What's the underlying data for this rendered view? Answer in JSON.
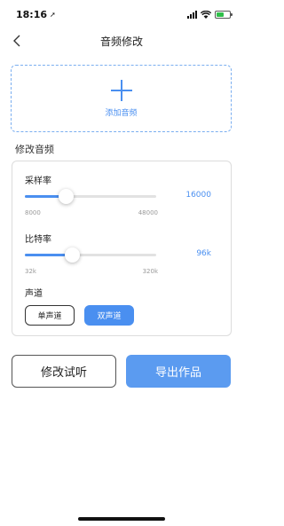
{
  "status_bar": {
    "time": "18:16",
    "location_glyph": "➚"
  },
  "nav": {
    "title": "音频修改",
    "back_icon": "chevron-left-icon"
  },
  "upload": {
    "label": "添加音频",
    "icon": "plus-icon"
  },
  "section": {
    "title": "修改音频"
  },
  "sample_rate": {
    "label": "采样率",
    "value": "16000",
    "min_label": "8000",
    "max_label": "48000",
    "fraction": 0.31
  },
  "bit_rate": {
    "label": "比特率",
    "value": "96k",
    "min_label": "32k",
    "max_label": "320k",
    "fraction": 0.36
  },
  "channel": {
    "label": "声道",
    "options": [
      "单声道",
      "双声道"
    ],
    "selected": "双声道"
  },
  "actions": {
    "preview_label": "修改试听",
    "export_label": "导出作品"
  },
  "colors": {
    "accent": "#4a8ff0",
    "export_button": "#5b9bf0"
  }
}
